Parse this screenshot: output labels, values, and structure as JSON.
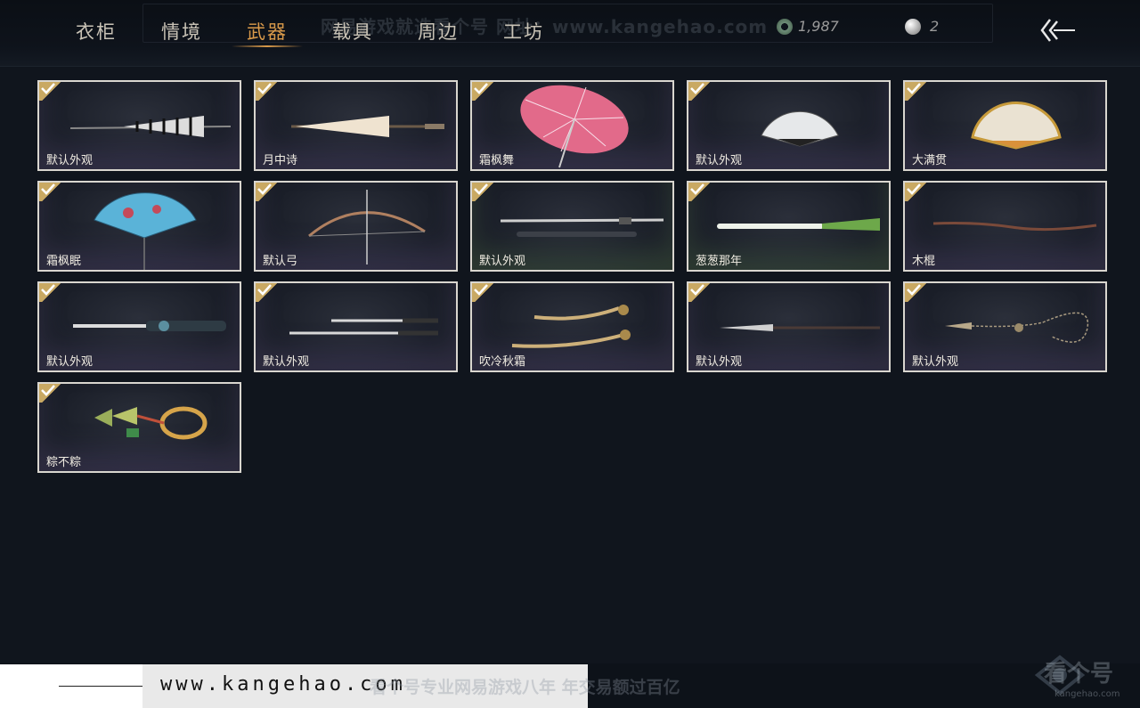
{
  "tabs": [
    {
      "label": "衣柜"
    },
    {
      "label": "情境"
    },
    {
      "label": "武器"
    },
    {
      "label": "载具"
    },
    {
      "label": "周边"
    },
    {
      "label": "工坊"
    }
  ],
  "active_tab": "武器",
  "watermark_top": "网易游戏就选看个号  网址：www.kangehao.com",
  "currency": {
    "coins": "1,987",
    "pearls": "2"
  },
  "items": [
    {
      "label": "默认外观",
      "icon": "closed-umbrella-striped-icon",
      "owned": true
    },
    {
      "label": "月中诗",
      "icon": "closed-umbrella-cream-icon",
      "owned": true
    },
    {
      "label": "霜枫舞",
      "icon": "open-umbrella-pink-icon",
      "owned": true
    },
    {
      "label": "默认外观",
      "icon": "folding-fan-white-icon",
      "owned": true
    },
    {
      "label": "大满贯",
      "icon": "folding-fan-gold-icon",
      "owned": true
    },
    {
      "label": "霜枫眠",
      "icon": "folding-fan-blue-icon",
      "owned": true
    },
    {
      "label": "默认弓",
      "icon": "bow-icon",
      "owned": true
    },
    {
      "label": "默认外观",
      "icon": "sword-scabbard-icon",
      "owned": true
    },
    {
      "label": "葱葱那年",
      "icon": "green-onion-icon",
      "owned": true
    },
    {
      "label": "木棍",
      "icon": "wooden-stick-icon",
      "owned": true
    },
    {
      "label": "默认外观",
      "icon": "long-sword-icon",
      "owned": true
    },
    {
      "label": "默认外观",
      "icon": "twin-blades-icon",
      "owned": true
    },
    {
      "label": "吹冷秋霜",
      "icon": "curved-blades-gold-icon",
      "owned": true
    },
    {
      "label": "默认外观",
      "icon": "spear-icon",
      "owned": true
    },
    {
      "label": "默认外观",
      "icon": "rope-dart-icon",
      "owned": true
    },
    {
      "label": "粽不粽",
      "icon": "zongzi-rope-dart-icon",
      "owned": true
    }
  ],
  "footer": {
    "url": "www.kangehao.com",
    "slogan": "看个号专业网易游戏八年  年交易额过百亿",
    "brand_name": "看个号",
    "brand_domain": "kangehao.com"
  },
  "colors": {
    "background": "#10151d",
    "active_tab": "#d99a4a",
    "check_badge": "#c9a963",
    "card_border": "#d9d6cf"
  }
}
